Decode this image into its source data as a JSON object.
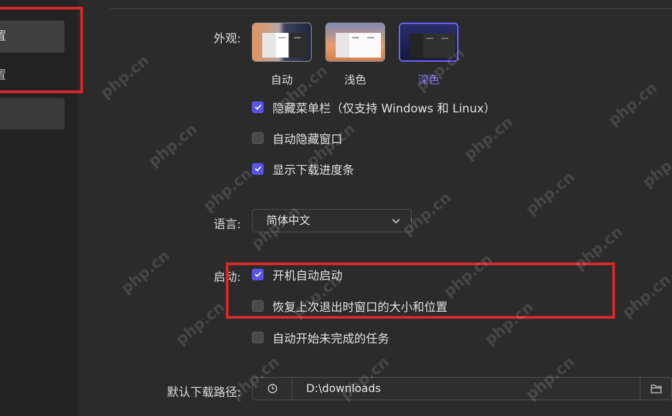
{
  "sidebar": {
    "items": [
      {
        "label": "置"
      },
      {
        "label": "置"
      },
      {
        "label": ""
      }
    ]
  },
  "appearance": {
    "label": "外观:",
    "themes": [
      {
        "name": "自动",
        "selected": false
      },
      {
        "name": "浅色",
        "selected": false
      },
      {
        "name": "深色",
        "selected": true
      }
    ]
  },
  "options": {
    "hide_menu": {
      "label": "隐藏菜单栏（仅支持 Windows 和 Linux）",
      "checked": true
    },
    "auto_hide_window": {
      "label": "自动隐藏窗口",
      "checked": false
    },
    "show_progress": {
      "label": "显示下载进度条",
      "checked": true
    }
  },
  "language": {
    "label": "语言:",
    "value": "简体中文"
  },
  "startup": {
    "label": "启动:",
    "auto_start": {
      "label": "开机自动启动",
      "checked": true
    },
    "restore_window": {
      "label": "恢复上次退出时窗口的大小和位置",
      "checked": false
    },
    "resume_tasks": {
      "label": "自动开始未完成的任务",
      "checked": false
    }
  },
  "download_path": {
    "label": "默认下载路径:",
    "value": "D:\\downloads"
  },
  "watermark": "php.cn",
  "colors": {
    "accent": "#5b52e8",
    "annotation": "#d42a2a"
  }
}
